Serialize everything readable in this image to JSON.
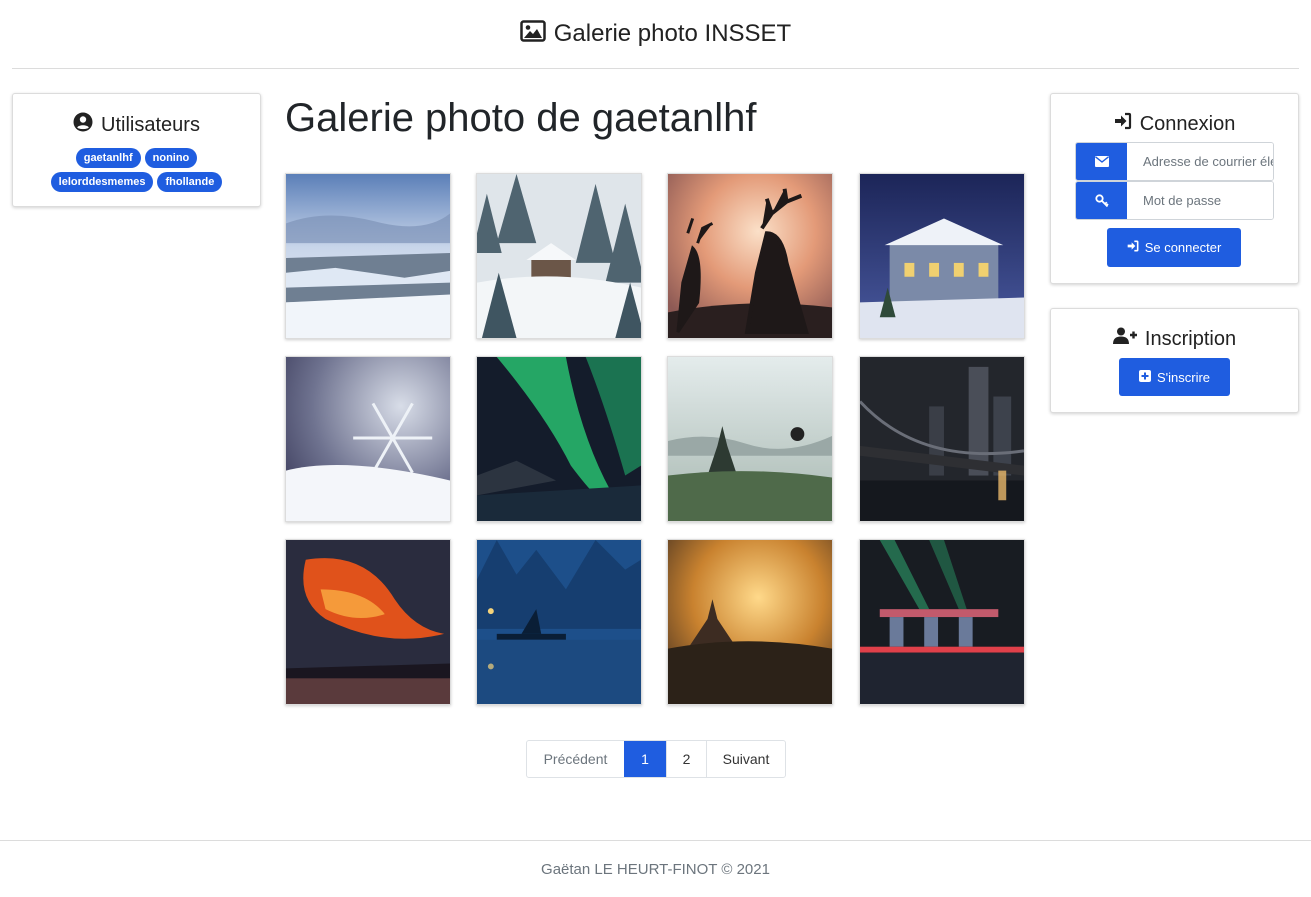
{
  "header": {
    "icon": "image-icon",
    "title": "Galerie photo INSSET"
  },
  "users": {
    "icon": "user-circle-icon",
    "title": "Utilisateurs",
    "list": [
      "gaetanlhf",
      "nonino",
      "lelorddesmemes",
      "fhollande"
    ]
  },
  "main": {
    "title": "Galerie photo de gaetanlhf"
  },
  "gallery": {
    "photos": [
      "frozen-waterfall",
      "snowy-cabin",
      "deer-sunset",
      "snowy-mansion",
      "snowflake",
      "aurora",
      "temples-balloon",
      "bridge-night",
      "red-cloud-sunset",
      "fisherman-river",
      "temple-sunset",
      "marina-bay-night"
    ]
  },
  "pagination": {
    "prev": "Précédent",
    "pages": [
      "1",
      "2"
    ],
    "active": "1",
    "next": "Suivant"
  },
  "login": {
    "icon": "sign-in-icon",
    "title": "Connexion",
    "email_placeholder": "Adresse de courrier électronique",
    "password_placeholder": "Mot de passe",
    "button": "Se connecter"
  },
  "register": {
    "icon": "user-plus-icon",
    "title": "Inscription",
    "button": "S'inscrire"
  },
  "footer": {
    "text": "Gaëtan LE HEURT-FINOT © 2021"
  },
  "colors": {
    "primary": "#1f5de0",
    "border": "#dcdcdc",
    "text": "#212529",
    "muted": "#6c757d"
  }
}
